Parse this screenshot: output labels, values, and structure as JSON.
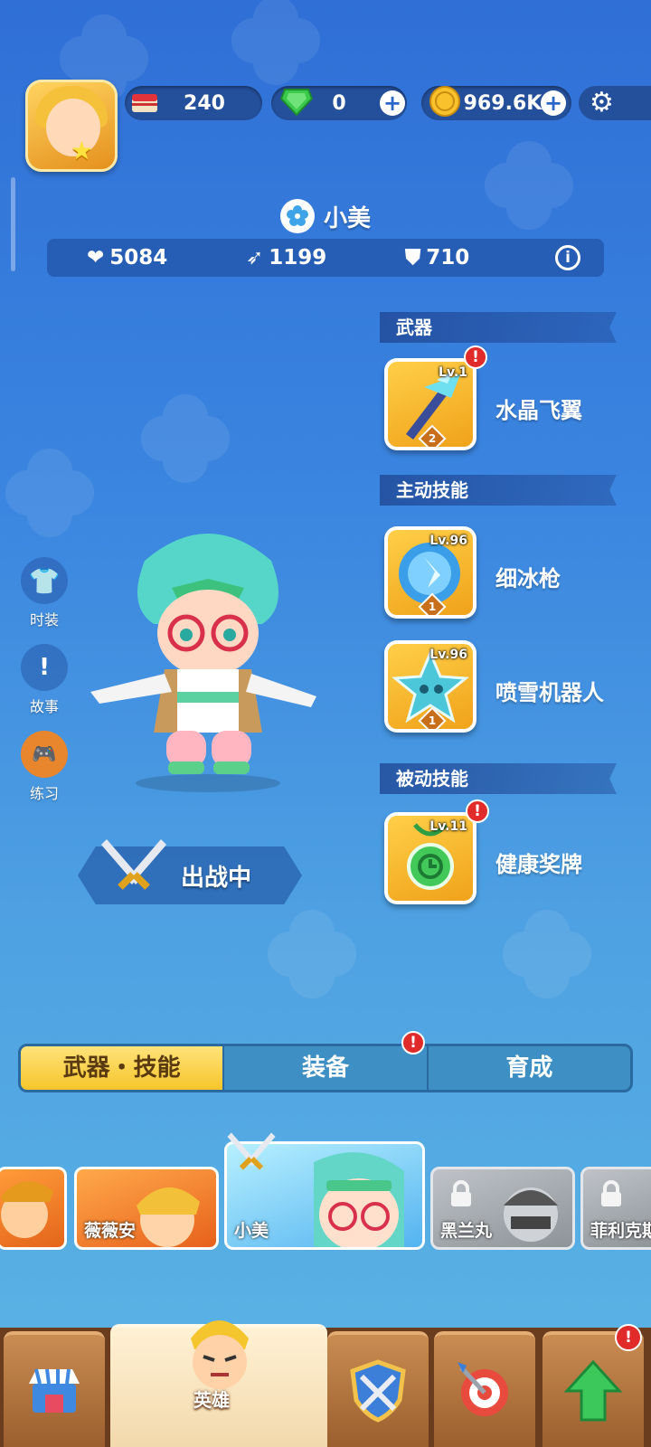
{
  "top_bar": {
    "cake_count": "240",
    "gem_count": "0",
    "coin_count": "969.6K"
  },
  "hero": {
    "name": "小美",
    "stats": {
      "hp": "5084",
      "attack": "1199",
      "defense": "710"
    }
  },
  "sections": {
    "weapon_title": "武器",
    "active_title": "主动技能",
    "passive_title": "被动技能"
  },
  "skills": [
    {
      "name": "水晶飞翼",
      "level": "Lv.1",
      "rank": "2"
    },
    {
      "name": "细冰枪",
      "level": "Lv.96",
      "rank": "1"
    },
    {
      "name": "喷雪机器人",
      "level": "Lv.96",
      "rank": "1"
    },
    {
      "name": "健康奖牌",
      "level": "Lv.11"
    }
  ],
  "side_menu": {
    "costume": "时装",
    "story": "故事",
    "practice": "练习"
  },
  "battle_label": "出战中",
  "tabs": [
    "武器・技能",
    "装备",
    "育成"
  ],
  "alert_mark": "!",
  "roster": [
    "薇薇安",
    "小美",
    "黑兰丸",
    "菲利克斯"
  ],
  "bottom_nav": {
    "heroes_label": "英雄"
  }
}
